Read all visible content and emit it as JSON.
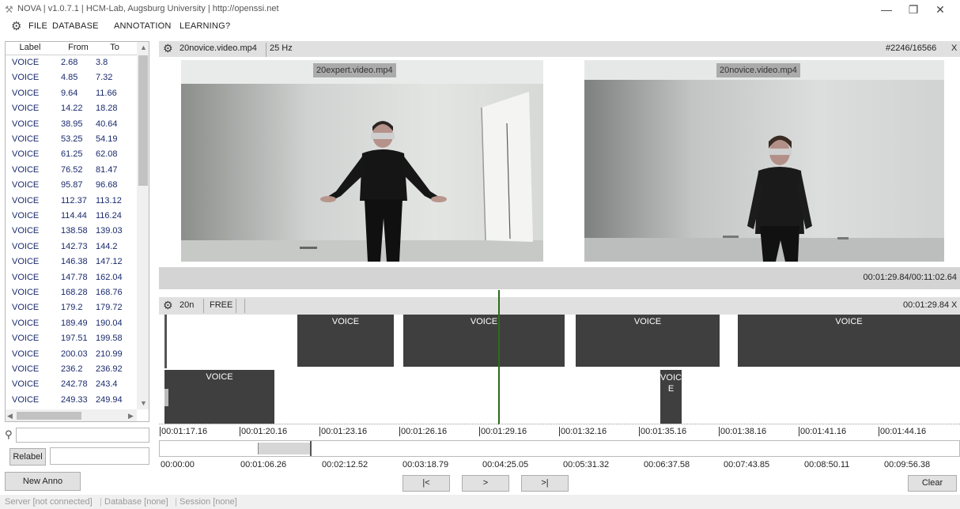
{
  "window": {
    "title": "NOVA | v1.0.7.1 | HCM-Lab, Augsburg University | http://openssi.net",
    "minimize_glyph": "—",
    "restore_glyph": "❐",
    "close_glyph": "✕"
  },
  "menu": [
    "FILE",
    "DATABASE",
    "ANNOTATION",
    "LEARNING",
    "?"
  ],
  "annotation_table": {
    "columns": [
      "Label",
      "From",
      "To"
    ],
    "rows": [
      [
        "VOICE",
        "2.68",
        "3.8"
      ],
      [
        "VOICE",
        "4.85",
        "7.32"
      ],
      [
        "VOICE",
        "9.64",
        "11.66"
      ],
      [
        "VOICE",
        "14.22",
        "18.28"
      ],
      [
        "VOICE",
        "38.95",
        "40.64"
      ],
      [
        "VOICE",
        "53.25",
        "54.19"
      ],
      [
        "VOICE",
        "61.25",
        "62.08"
      ],
      [
        "VOICE",
        "76.52",
        "81.47"
      ],
      [
        "VOICE",
        "95.87",
        "96.68"
      ],
      [
        "VOICE",
        "112.37",
        "113.12"
      ],
      [
        "VOICE",
        "114.44",
        "116.24"
      ],
      [
        "VOICE",
        "138.58",
        "139.03"
      ],
      [
        "VOICE",
        "142.73",
        "144.2"
      ],
      [
        "VOICE",
        "146.38",
        "147.12"
      ],
      [
        "VOICE",
        "147.78",
        "162.04"
      ],
      [
        "VOICE",
        "168.28",
        "168.76"
      ],
      [
        "VOICE",
        "179.2",
        "179.72"
      ],
      [
        "VOICE",
        "189.49",
        "190.04"
      ],
      [
        "VOICE",
        "197.51",
        "199.58"
      ],
      [
        "VOICE",
        "200.03",
        "210.99"
      ],
      [
        "VOICE",
        "236.2",
        "236.92"
      ],
      [
        "VOICE",
        "242.78",
        "243.4"
      ],
      [
        "VOICE",
        "249.33",
        "249.94"
      ]
    ]
  },
  "search": {
    "value": ""
  },
  "relabel": {
    "button": "Relabel",
    "value": ""
  },
  "new_anno": "New Anno",
  "status": {
    "server": "Server [not connected]",
    "database": "Database [none]",
    "session": "Session [none]"
  },
  "video_header": {
    "file": "20novice.video.mp4",
    "rate": "25 Hz",
    "frame": "#2246/16566",
    "close": "X"
  },
  "videos": [
    {
      "label": "20expert.video.mp4"
    },
    {
      "label": "20novice.video.mp4"
    }
  ],
  "position": "00:01:29.84/00:11:02.64",
  "tier_header": {
    "name": "20n",
    "mode": "FREE",
    "time": "00:01:29.84",
    "close": "X"
  },
  "segments": {
    "track1": [
      {
        "label": "VOICE"
      },
      {
        "label": "VOICE"
      },
      {
        "label": "VOICE"
      },
      {
        "label": "VOICE"
      }
    ],
    "track2": [
      {
        "label": "VOICE"
      },
      {
        "label": "VOIC E"
      }
    ]
  },
  "timeline_ticks": [
    "00:01:17.16",
    "00:01:20.16",
    "00:01:23.16",
    "00:01:26.16",
    "00:01:29.16",
    "00:01:32.16",
    "00:01:35.16",
    "00:01:38.16",
    "00:01:41.16",
    "00:01:44.16"
  ],
  "overview_ticks": [
    "00:00:00",
    "00:01:06.26",
    "00:02:12.52",
    "00:03:18.79",
    "00:04:25.05",
    "00:05:31.32",
    "00:06:37.58",
    "00:07:43.85",
    "00:08:50.11",
    "00:09:56.38"
  ],
  "nav": {
    "first": "|<",
    "play": ">",
    "last": ">|"
  },
  "clear": "Clear"
}
